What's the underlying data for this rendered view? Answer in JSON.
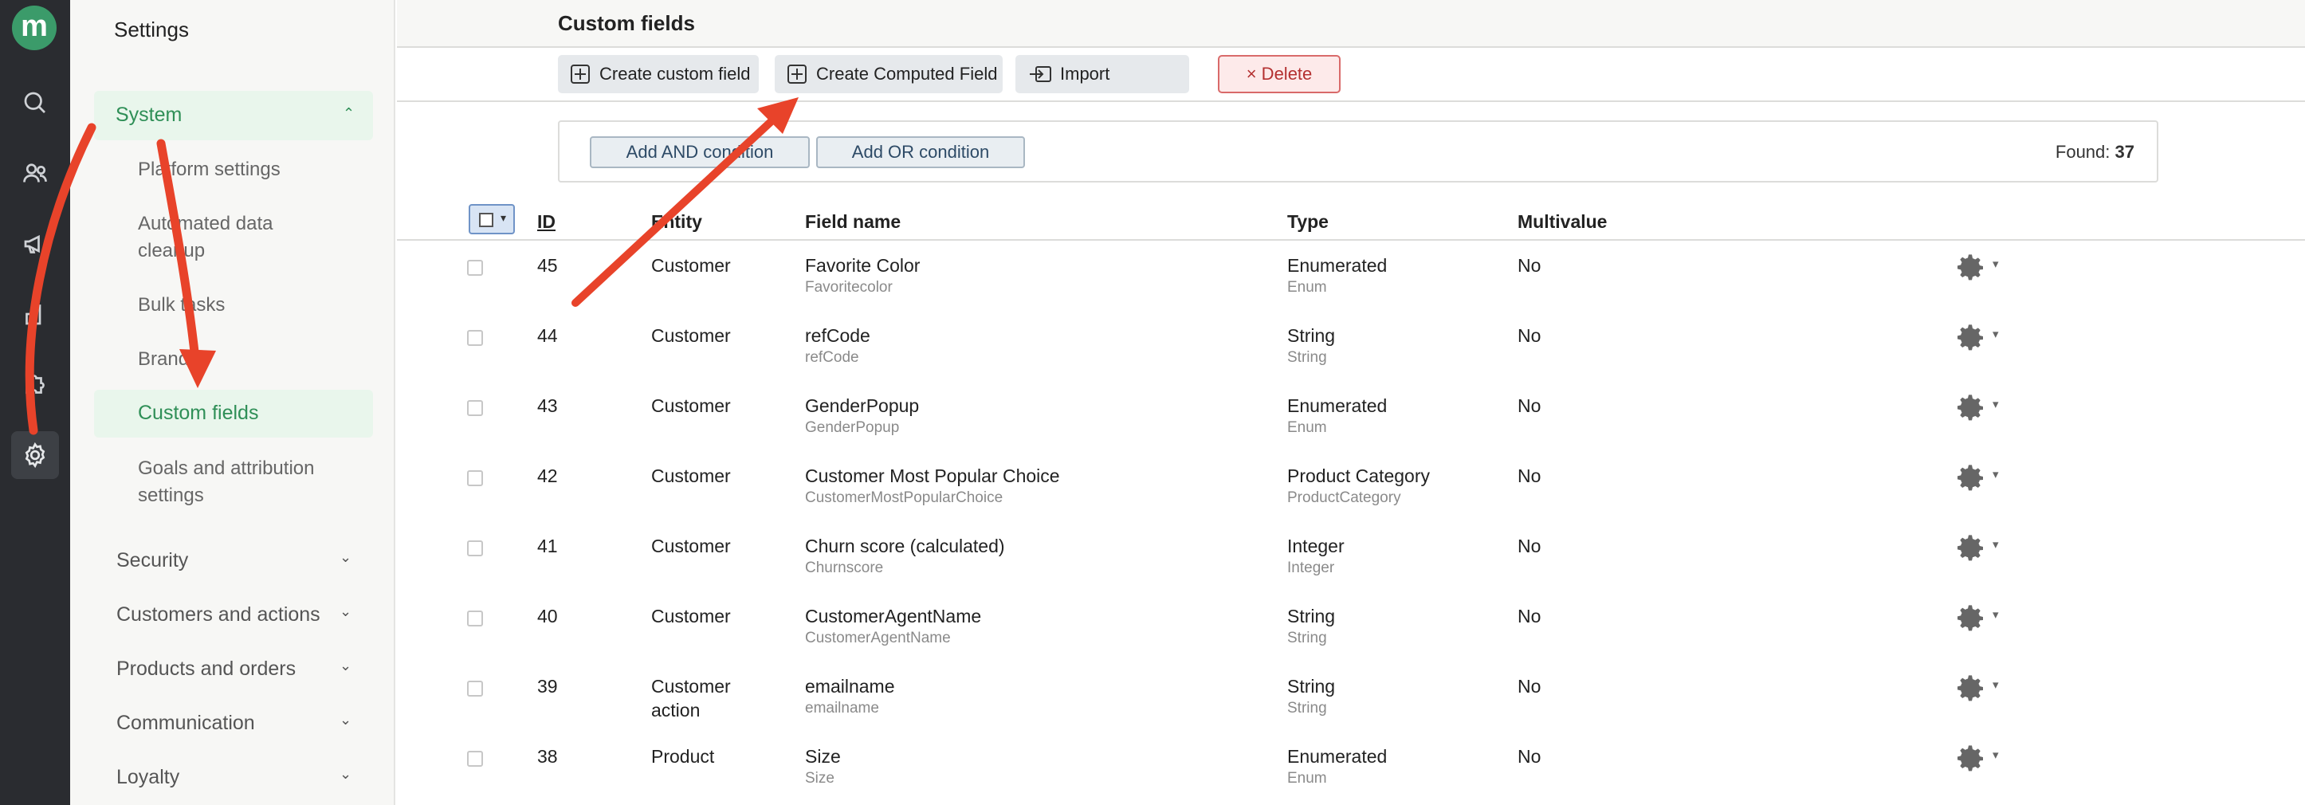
{
  "sidebar": {
    "title": "Settings",
    "active_section": "System",
    "system_items": [
      {
        "label": "Platform settings"
      },
      {
        "label": "Automated data cleanup"
      },
      {
        "label": "Bulk tasks"
      },
      {
        "label": "Brand"
      },
      {
        "label": "Custom fields",
        "active": true
      },
      {
        "label": "Goals and attribution settings"
      }
    ],
    "sections": [
      {
        "label": "Security"
      },
      {
        "label": "Customers and actions"
      },
      {
        "label": "Products and orders"
      },
      {
        "label": "Communication"
      },
      {
        "label": "Loyalty"
      }
    ]
  },
  "rail": {
    "logo": "m",
    "icons": [
      "search-icon",
      "users-icon",
      "megaphone-icon",
      "chart-icon",
      "puzzle-icon",
      "gear-icon"
    ]
  },
  "page": {
    "title": "Custom fields"
  },
  "toolbar": {
    "create_custom_label": "Create custom field",
    "create_computed_label": "Create Computed Field",
    "import_label": "Import",
    "delete_label": "× Delete"
  },
  "filter": {
    "add_and_label": "Add AND condition",
    "add_or_label": "Add OR condition",
    "found_label": "Found:",
    "found_count": "37"
  },
  "table": {
    "columns": {
      "id": "ID",
      "entity": "Entity",
      "field_name": "Field name",
      "type": "Type",
      "multivalue": "Multivalue"
    },
    "rows": [
      {
        "id": "45",
        "entity": "Customer",
        "name": "Favorite Color",
        "system_name": "Favoritecolor",
        "type": "Enumerated",
        "type_code": "Enum",
        "multivalue": "No"
      },
      {
        "id": "44",
        "entity": "Customer",
        "name": "refCode",
        "system_name": "refCode",
        "type": "String",
        "type_code": "String",
        "multivalue": "No"
      },
      {
        "id": "43",
        "entity": "Customer",
        "name": "GenderPopup",
        "system_name": "GenderPopup",
        "type": "Enumerated",
        "type_code": "Enum",
        "multivalue": "No"
      },
      {
        "id": "42",
        "entity": "Customer",
        "name": "Customer Most Popular Choice",
        "system_name": "CustomerMostPopularChoice",
        "type": "Product Category",
        "type_code": "ProductCategory",
        "multivalue": "No"
      },
      {
        "id": "41",
        "entity": "Customer",
        "name": "Churn score (calculated)",
        "system_name": "Churnscore",
        "type": "Integer",
        "type_code": "Integer",
        "multivalue": "No"
      },
      {
        "id": "40",
        "entity": "Customer",
        "name": "CustomerAgentName",
        "system_name": "CustomerAgentName",
        "type": "String",
        "type_code": "String",
        "multivalue": "No"
      },
      {
        "id": "39",
        "entity": "Customer\naction",
        "name": "emailname",
        "system_name": "emailname",
        "type": "String",
        "type_code": "String",
        "multivalue": "No"
      },
      {
        "id": "38",
        "entity": "Product",
        "name": "Size",
        "system_name": "Size",
        "type": "Enumerated",
        "type_code": "Enum",
        "multivalue": "No"
      }
    ]
  },
  "colors": {
    "accent_green": "#2f8f57",
    "annotation_red": "#e8432a",
    "rail_bg": "#2a2c30"
  }
}
